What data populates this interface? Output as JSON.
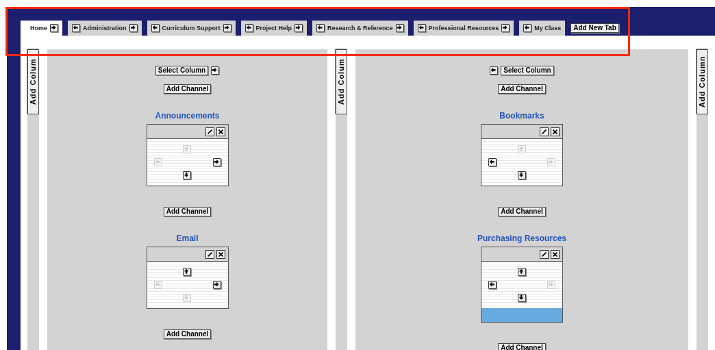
{
  "tabs": [
    {
      "label": "Home",
      "selected": true,
      "move_left": false,
      "move_right": true
    },
    {
      "label": "Administration",
      "selected": false,
      "move_left": true,
      "move_right": true
    },
    {
      "label": "Curriculum Support",
      "selected": false,
      "move_left": true,
      "move_right": true
    },
    {
      "label": "Project Help",
      "selected": false,
      "move_left": true,
      "move_right": true
    },
    {
      "label": "Research & Reference",
      "selected": false,
      "move_left": true,
      "move_right": true
    },
    {
      "label": "Professional Resources",
      "selected": false,
      "move_left": true,
      "move_right": true
    },
    {
      "label": "My Class",
      "selected": false,
      "move_left": true,
      "move_right": false
    }
  ],
  "add_tab_button": "Add New Tab",
  "add_column_buttons": [
    "Add Colum",
    "Add Colum",
    "Add Column"
  ],
  "columns": [
    {
      "select_label": "Select Column",
      "move_left": false,
      "move_right": true,
      "add_channel_buttons": [
        "Add Channel",
        "Add Channel",
        "Add Channel"
      ],
      "channels": [
        {
          "title": "Announcements",
          "selected": false,
          "up": false,
          "left": false,
          "right": true,
          "down": true
        },
        {
          "title": "Email",
          "selected": false,
          "up": true,
          "left": false,
          "right": true,
          "down": false
        }
      ]
    },
    {
      "select_label": "Select Column",
      "move_left": true,
      "move_right": false,
      "add_channel_buttons": [
        "Add Channel",
        "Add Channel",
        "Add Channel"
      ],
      "channels": [
        {
          "title": "Bookmarks",
          "selected": false,
          "up": false,
          "left": true,
          "right": false,
          "down": true
        },
        {
          "title": "Purchasing Resources",
          "selected": true,
          "up": true,
          "left": true,
          "right": false,
          "down": true
        }
      ]
    }
  ]
}
